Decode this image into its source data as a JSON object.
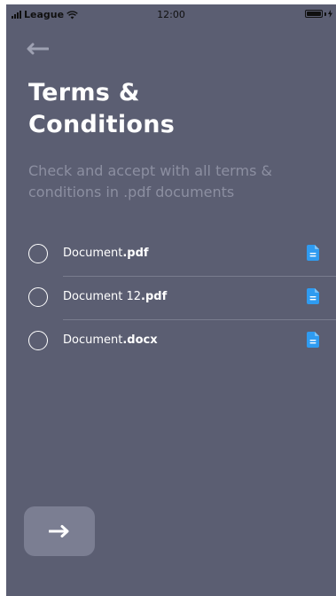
{
  "status_bar": {
    "carrier": "League",
    "time": "12:00",
    "icons": [
      "signal-icon",
      "wifi-icon",
      "battery-icon",
      "charging-icon"
    ]
  },
  "header": {
    "back_icon": "arrow-left-icon",
    "title_line1": "Terms &",
    "title_line2": "Conditions",
    "subtitle": "Check and accept with all terms & conditions in .pdf documents"
  },
  "documents": [
    {
      "name": "Document",
      "ext": ".pdf",
      "icon": "file-icon"
    },
    {
      "name": "Document 12",
      "ext": ".pdf",
      "icon": "file-icon"
    },
    {
      "name": "Document",
      "ext": ".docx",
      "icon": "file-icon"
    }
  ],
  "footer": {
    "next_icon": "arrow-right-icon"
  },
  "colors": {
    "background": "#5b5e72",
    "button": "#7b7e92",
    "accent": "#2f9bf0",
    "text": "#ffffff",
    "muted_text": "#8c8fa1"
  }
}
